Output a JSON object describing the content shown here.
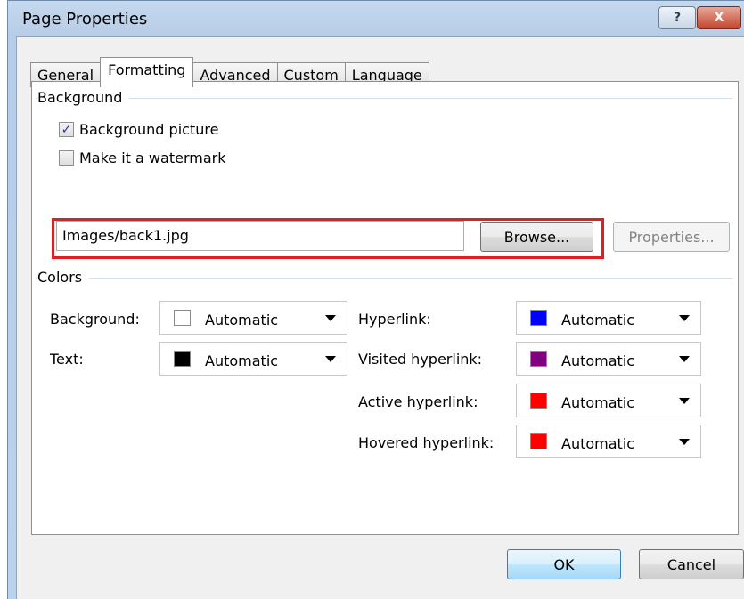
{
  "window": {
    "title": "Page Properties",
    "help_label": "?",
    "close_label": "X"
  },
  "tabs": [
    {
      "label": "General",
      "active": false
    },
    {
      "label": "Formatting",
      "active": true
    },
    {
      "label": "Advanced",
      "active": false
    },
    {
      "label": "Custom",
      "active": false
    },
    {
      "label": "Language",
      "active": false
    }
  ],
  "background_group": {
    "title": "Background",
    "background_picture": {
      "label": "Background picture",
      "checked": true,
      "mark": "✓"
    },
    "watermark": {
      "label": "Make it a watermark",
      "checked": false
    },
    "path_value": "Images/back1.jpg",
    "browse_label": "Browse...",
    "properties_label": "Properties..."
  },
  "colors_group": {
    "title": "Colors",
    "background": {
      "label": "Background:",
      "value": "Automatic",
      "swatch": "#ffffff"
    },
    "text": {
      "label": "Text:",
      "value": "Automatic",
      "swatch": "#000000"
    },
    "hyperlink": {
      "label": "Hyperlink:",
      "value": "Automatic",
      "swatch": "#0000ff"
    },
    "visited_hyperlink": {
      "label": "Visited hyperlink:",
      "value": "Automatic",
      "swatch": "#800080"
    },
    "active_hyperlink": {
      "label": "Active hyperlink:",
      "value": "Automatic",
      "swatch": "#ff0000"
    },
    "hovered_hyperlink": {
      "label": "Hovered hyperlink:",
      "value": "Automatic",
      "swatch": "#ff0000"
    }
  },
  "footer": {
    "ok_label": "OK",
    "cancel_label": "Cancel"
  }
}
